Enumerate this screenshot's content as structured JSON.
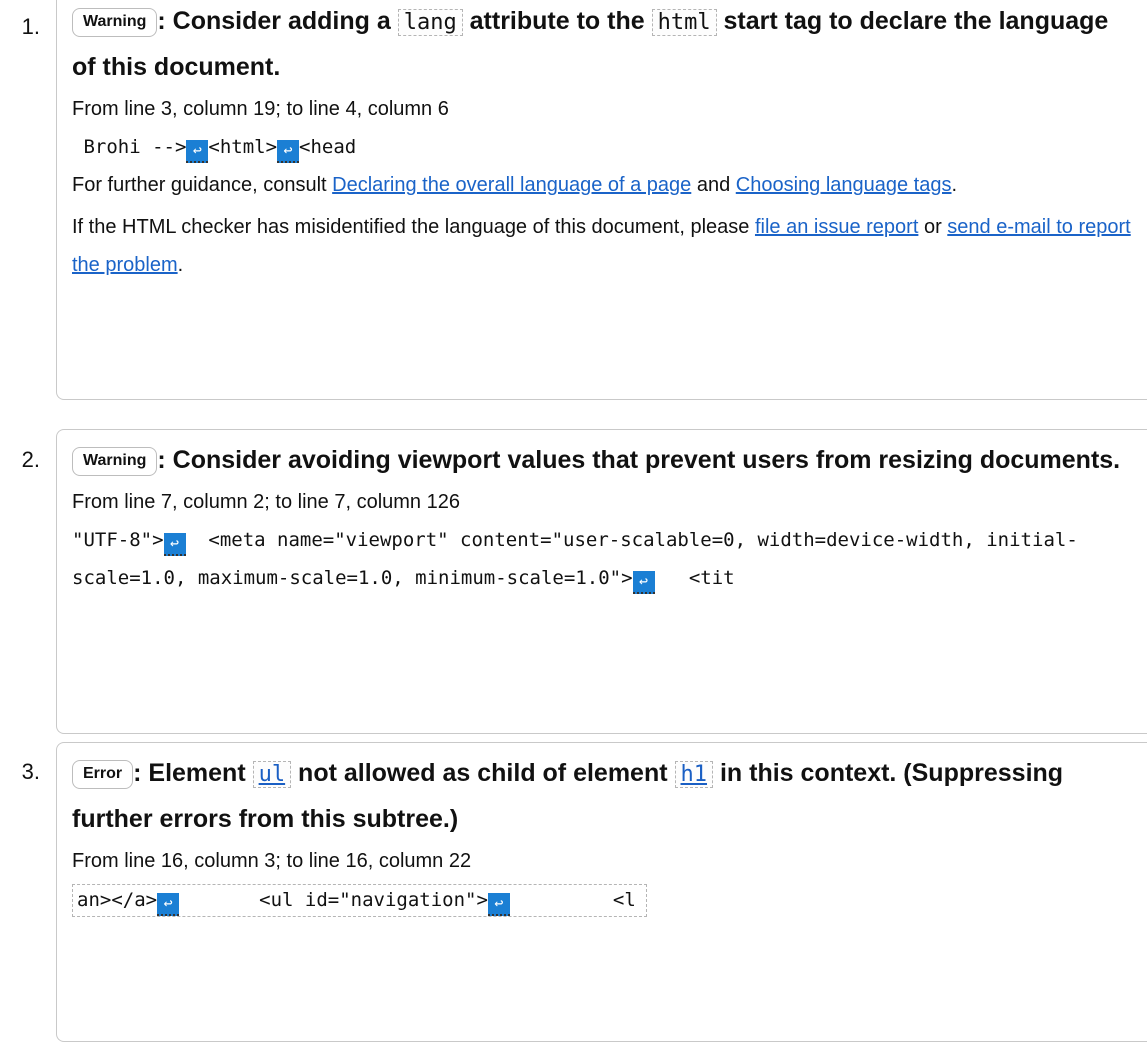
{
  "messages": [
    {
      "number": "1.",
      "badge": "Warning",
      "title_parts": [
        ": Consider adding a ",
        "lang",
        " attribute to the ",
        "html",
        " start tag to declare the language of this document."
      ],
      "location": "From line 3, column 19; to line 4, column 6",
      "extract": [
        " Brohi -->",
        "<html>",
        "<head"
      ],
      "guidance_pre": "For further guidance, consult ",
      "guidance_link1": "Declaring the overall language of a page",
      "guidance_mid": " and ",
      "guidance_link2": "Choosing language tags",
      "guidance_post": ".",
      "misid_pre": "If the HTML checker has misidentified the language of this document, please ",
      "misid_link1": "file an issue report",
      "misid_mid": " or ",
      "misid_link2": "send e-mail to report the problem",
      "misid_post": "."
    },
    {
      "number": "2.",
      "badge": "Warning",
      "title_text": ": Consider avoiding viewport values that prevent users from resizing documents.",
      "location": "From line 7, column 2; to line 7, column 126",
      "extract_a": "\"UTF-8\">",
      "extract_b": "  <meta name=\"viewport\" content=\"user-scalable=0, width=device-width, initial-scale=1.0, maximum-scale=1.0, minimum-scale=1.0\">",
      "extract_c": "   <tit"
    },
    {
      "number": "3.",
      "badge": "Error",
      "title_parts": [
        ": Element ",
        "ul",
        " not allowed as child of element ",
        "h1",
        " in this context. (Suppressing further errors from this subtree.)"
      ],
      "location": "From line 16, column 3; to line 16, column 22",
      "extract_a": "an></a>",
      "extract_b": "       <ul id=\"navigation\">",
      "extract_c": "         <l"
    }
  ],
  "icons": {
    "line_break": "line-break-icon",
    "line_break_color": "#1b7fd4"
  },
  "colors": {
    "link": "#1a63c8",
    "border": "#c9c9c9"
  }
}
